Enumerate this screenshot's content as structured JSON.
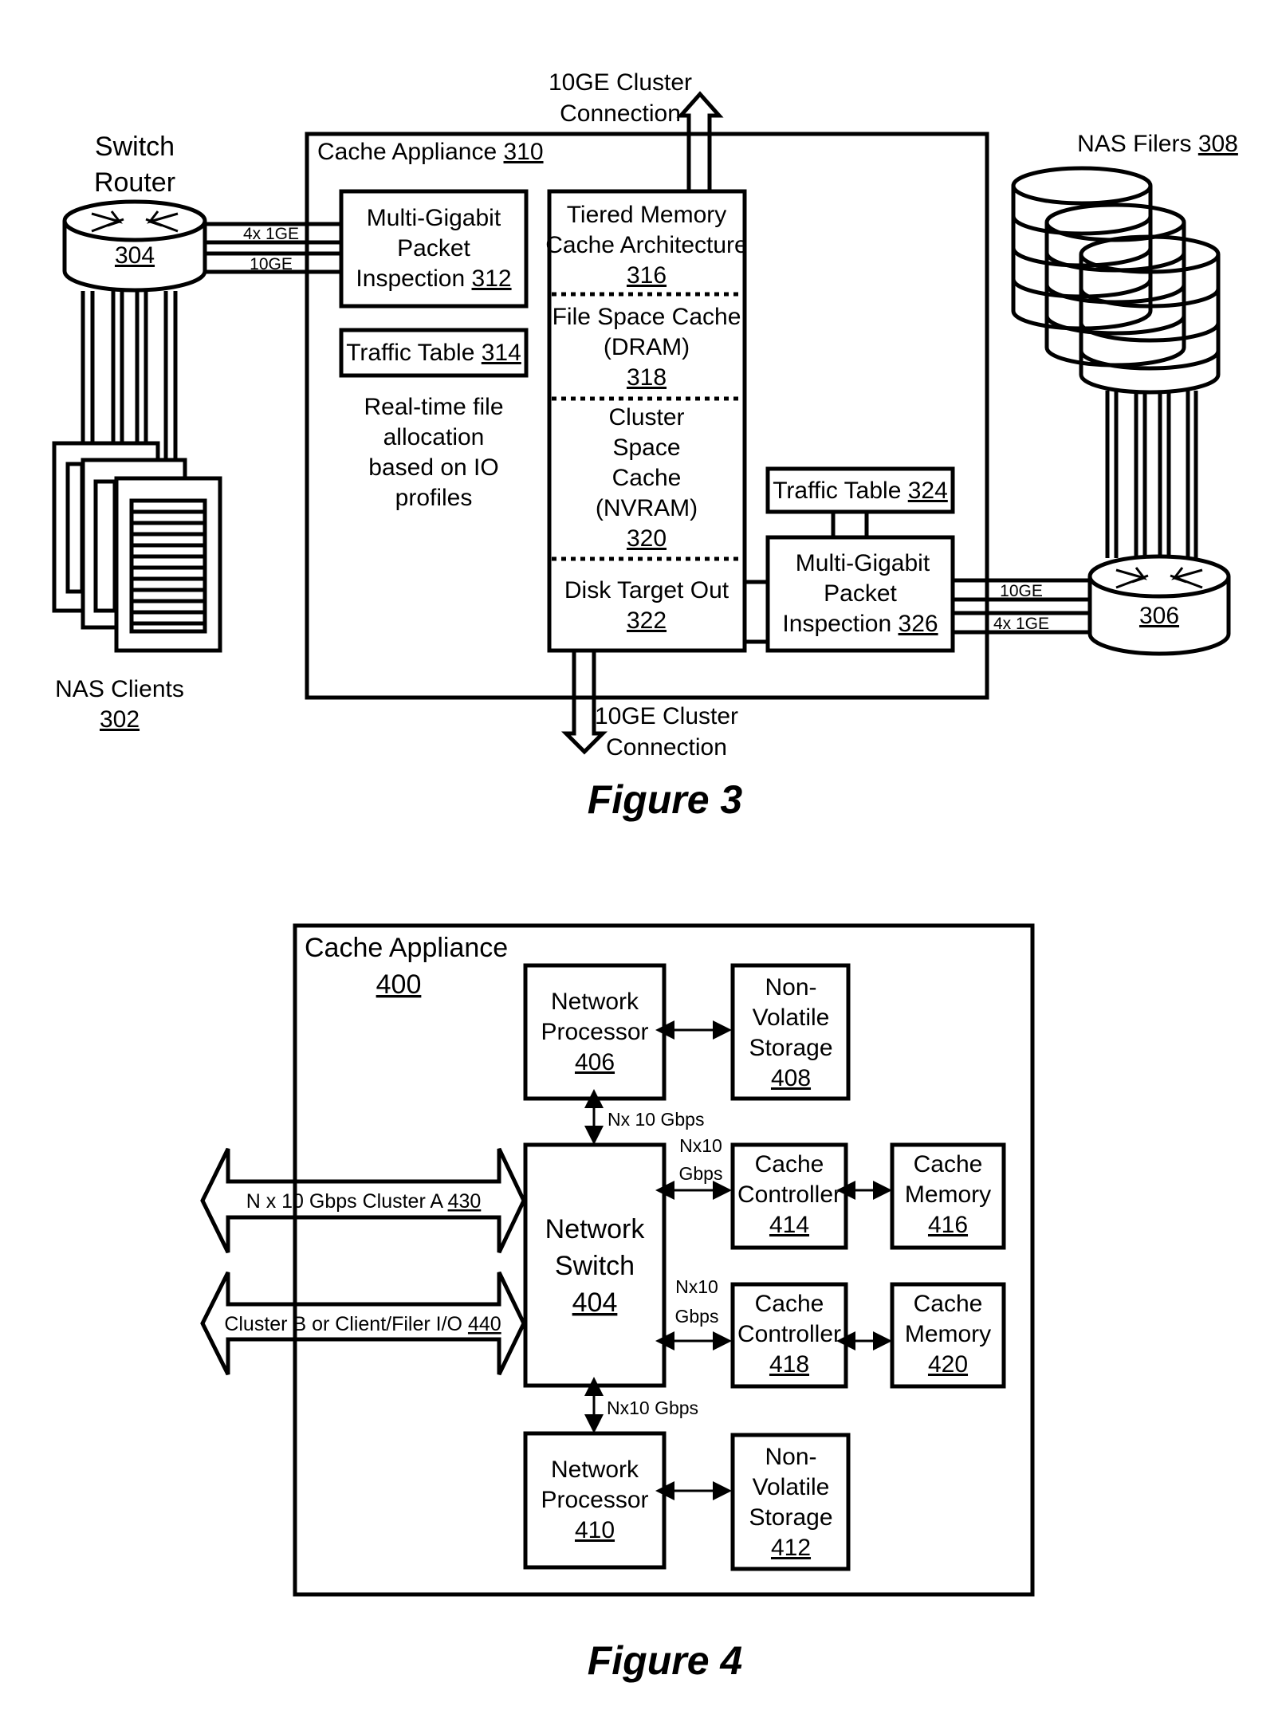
{
  "figure3": {
    "caption": "Figure 3",
    "switch_router": {
      "line1": "Switch",
      "line2": "Router",
      "ref": "304"
    },
    "cache_appliance": {
      "label": "Cache Appliance ",
      "ref": "310"
    },
    "link_left_top": "4x 1GE",
    "link_left_bottom": "10GE",
    "mgpi_312": {
      "line1": "Multi-Gigabit",
      "line2": "Packet",
      "line3": "Inspection ",
      "ref": "312"
    },
    "traffic_table_314": {
      "label": "Traffic Table ",
      "ref": "314"
    },
    "realtime_note": {
      "line1": "Real-time file",
      "line2": "allocation",
      "line3": "based on IO",
      "line4": "profiles"
    },
    "tiered_memory": {
      "line1": "Tiered Memory",
      "line2": "Cache Architecture",
      "ref": "316"
    },
    "file_space_cache": {
      "line1": "File Space Cache",
      "line2": "(DRAM)",
      "ref": "318"
    },
    "cluster_space_cache": {
      "line1": "Cluster",
      "line2": "Space",
      "line3": "Cache",
      "line4": "(NVRAM)",
      "ref": "320"
    },
    "disk_target_out": {
      "line1": "Disk Target Out",
      "ref": "322"
    },
    "cluster_conn_top": {
      "line1": "10GE Cluster",
      "line2": "Connection"
    },
    "cluster_conn_bottom": {
      "line1": "10GE Cluster",
      "line2": "Connection"
    },
    "traffic_table_324": {
      "label": "Traffic Table ",
      "ref": "324"
    },
    "mgpi_326": {
      "line1": "Multi-Gigabit",
      "line2": "Packet",
      "line3": "Inspection ",
      "ref": "326"
    },
    "link_right_top": "10GE",
    "link_right_bottom": "4x 1GE",
    "router_306": {
      "ref": "306"
    },
    "nas_filers": {
      "label": "NAS Filers ",
      "ref": "308"
    },
    "nas_clients": {
      "label": "NAS Clients",
      "ref": "302"
    }
  },
  "figure4": {
    "caption": "Figure 4",
    "cache_appliance": {
      "label": "Cache Appliance",
      "ref": "400"
    },
    "network_processor_406": {
      "line1": "Network",
      "line2": "Processor",
      "ref": "406"
    },
    "nv_storage_408": {
      "line1": "Non-",
      "line2": "Volatile",
      "line3": "Storage",
      "ref": "408"
    },
    "network_switch_404": {
      "line1": "Network",
      "line2": "Switch",
      "ref": "404"
    },
    "cache_controller_414": {
      "line1": "Cache",
      "line2": "Controller",
      "ref": "414"
    },
    "cache_memory_416": {
      "line1": "Cache",
      "line2": "Memory",
      "ref": "416"
    },
    "cache_controller_418": {
      "line1": "Cache",
      "line2": "Controller",
      "ref": "418"
    },
    "cache_memory_420": {
      "line1": "Cache",
      "line2": "Memory",
      "ref": "420"
    },
    "network_processor_410": {
      "line1": "Network",
      "line2": "Processor",
      "ref": "410"
    },
    "nv_storage_412": {
      "line1": "Non-",
      "line2": "Volatile",
      "line3": "Storage",
      "ref": "412"
    },
    "link_np406_switch": "Nx 10 Gbps",
    "link_switch_cc414": {
      "line1": "Nx10",
      "line2": "Gbps"
    },
    "link_switch_cc418": {
      "line1": "Nx10",
      "line2": "Gbps"
    },
    "link_switch_np410": "Nx10 Gbps",
    "cluster_a": {
      "label": "N x 10 Gbps Cluster A ",
      "ref": "430"
    },
    "cluster_b": {
      "label": "Cluster B or Client/Filer I/O ",
      "ref": "440"
    }
  }
}
